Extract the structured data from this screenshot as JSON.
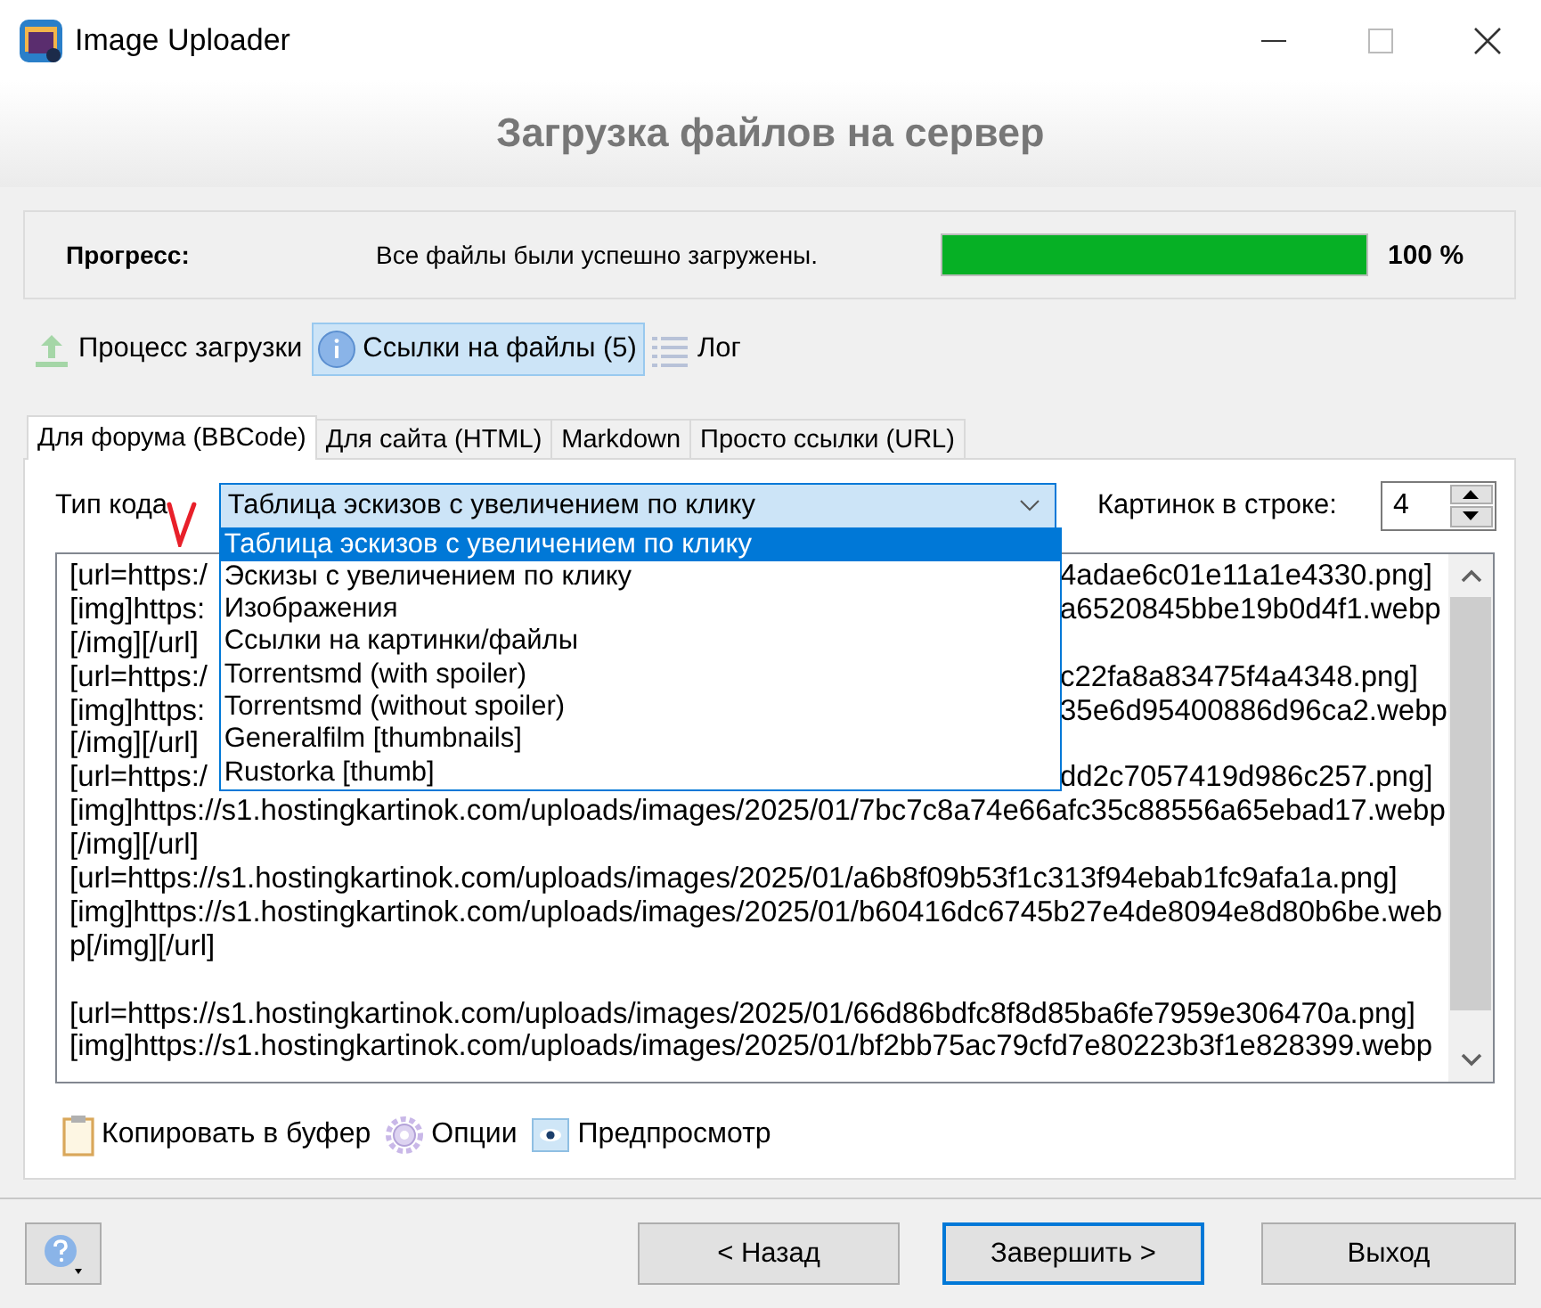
{
  "window": {
    "title": "Image Uploader"
  },
  "header": {
    "title": "Загрузка файлов на сервер"
  },
  "progress": {
    "label": "Прогресс:",
    "message": "Все файлы были успешно загружены.",
    "level": 1,
    "reading": "100 %"
  },
  "modes": [
    {
      "label": "Процесс загрузки",
      "kind": "upload",
      "selected": false
    },
    {
      "label": "Ссылки на файлы (5)",
      "kind": "info",
      "selected": true
    },
    {
      "label": "Лог",
      "kind": "list",
      "selected": false
    }
  ],
  "tabs": [
    {
      "label": "Для форума (BBCode)",
      "selected": true
    },
    {
      "label": "Для сайта (HTML)",
      "selected": false
    },
    {
      "label": "Markdown",
      "selected": false
    },
    {
      "label": "Просто ссылки (URL)",
      "selected": false
    }
  ],
  "code_type": {
    "label": "Тип кода",
    "value": "Таблица эскизов с увеличением по клику",
    "expanded": true,
    "options": [
      {
        "label": "Таблица эскизов с увеличением по клику",
        "selected": true
      },
      {
        "label": "Эскизы с увеличением по клику",
        "selected": false
      },
      {
        "label": "Изображения",
        "selected": false
      },
      {
        "label": "Ссылки на картинки/файлы",
        "selected": false
      },
      {
        "label": "Torrentsmd (with spoiler)",
        "selected": false
      },
      {
        "label": "Torrentsmd (without spoiler)",
        "selected": false
      },
      {
        "label": "Generalfilm [thumbnails]",
        "selected": false
      },
      {
        "label": "Rustorka [thumb]",
        "selected": false
      }
    ]
  },
  "per_row": {
    "label": "Картинок в строке:",
    "value": "4"
  },
  "output": {
    "lines": [
      {
        "text": "[url=https:/",
        "right": "4adae6c01e11a1e4330.png]"
      },
      {
        "text": "[img]https:",
        "right": "a6520845bbe19b0d4f1.webp"
      },
      {
        "text": "[/img][/url]"
      },
      {
        "text": "[url=https:/",
        "right": "c22fa8a83475f4a4348.png]"
      },
      {
        "text": "[img]https:",
        "right": "35e6d95400886d96ca2.webp"
      },
      {
        "text": "[/img][/url]"
      },
      {
        "text": "[url=https:/",
        "right": "dd2c7057419d986c257.png]"
      },
      {
        "text": "[img]https://s1.hostingkartinok.com/uploads/images/2025/01/7bc7c8a74e66afc35c88556a65ebad17.webp"
      },
      {
        "text": "[/img][/url]"
      },
      {
        "text": "[url=https://s1.hostingkartinok.com/uploads/images/2025/01/a6b8f09b53f1c313f94ebab1fc9afa1a.png]"
      },
      {
        "text": "[img]https://s1.hostingkartinok.com/uploads/images/2025/01/b60416dc6745b27e4de8094e8d80b6be.web"
      },
      {
        "text": "p[/img][/url]"
      },
      {
        "text": "[url=https://s1.hostingkartinok.com/uploads/images/2025/01/66d86bdfc8f8d85ba6fe7959e306470a.png]",
        "gap_before": true
      },
      {
        "text": "[img]https://s1.hostingkartinok.com/uploads/images/2025/01/bf2bb75ac79cfd7e80223b3f1e828399.webp"
      }
    ]
  },
  "actions": [
    {
      "label": "Копировать в буфер",
      "kind": "clipboard"
    },
    {
      "label": "Опции",
      "kind": "gear"
    },
    {
      "label": "Предпросмотр",
      "kind": "preview"
    }
  ],
  "footer": {
    "buttons": [
      {
        "label": "< Назад",
        "default": false
      },
      {
        "label": "Завершить >",
        "default": true
      },
      {
        "label": "Выход",
        "default": false
      }
    ]
  }
}
